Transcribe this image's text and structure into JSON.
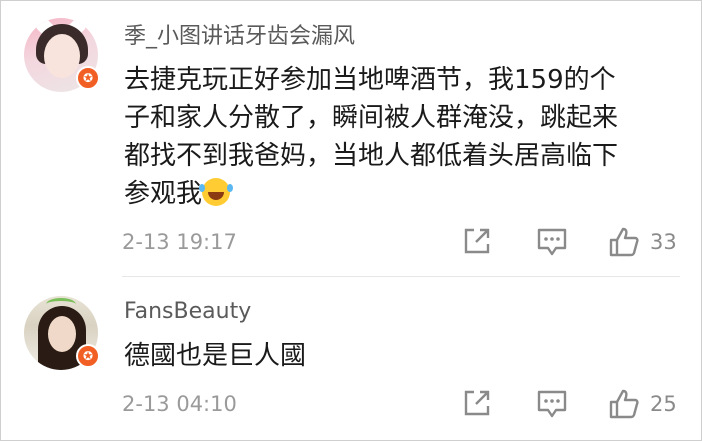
{
  "comments": [
    {
      "username": "季_小图讲话牙齿会漏风",
      "text_lines": [
        "去捷克玩正好参加当地啤酒节，我159的个",
        "子和家人分散了，瞬间被人群淹没，跳起来",
        "都找不到我爸妈，当地人都低着头居高临下",
        "参观我"
      ],
      "emoji": "laughing-crying-emoji",
      "timestamp": "2-13 19:17",
      "like_count": "33",
      "badge_icon": "verified-badge-icon"
    },
    {
      "username": "FansBeauty",
      "text_lines": [
        "德國也是巨人國"
      ],
      "timestamp": "2-13 04:10",
      "like_count": "25",
      "badge_icon": "verified-badge-icon"
    }
  ],
  "icons": {
    "share": "share-icon",
    "reply": "reply-icon",
    "like": "thumbs-up-icon"
  },
  "colors": {
    "badge": "#f25f24",
    "meta_text": "#9a9a9a",
    "username": "#5a5a5a"
  }
}
